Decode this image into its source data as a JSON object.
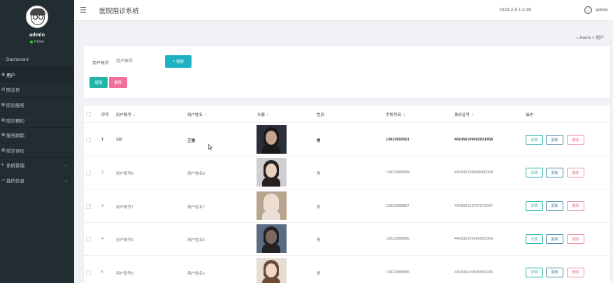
{
  "sidebar": {
    "user_name": "admin",
    "status": "Online",
    "items": [
      {
        "label": "Dashboard",
        "icon": "dashboard-icon",
        "glyph": "◌"
      },
      {
        "label": "用户",
        "icon": "grid-icon",
        "glyph": "▦"
      },
      {
        "label": "陪诊员",
        "icon": "grid-icon",
        "glyph": "▤"
      },
      {
        "label": "陪诊服务",
        "icon": "grid-icon",
        "glyph": "▦"
      },
      {
        "label": "陪诊预约",
        "icon": "grid-icon",
        "glyph": "▦"
      },
      {
        "label": "服务跟踪",
        "icon": "grid-icon",
        "glyph": "▦"
      },
      {
        "label": "陪诊评价",
        "icon": "grid-icon",
        "glyph": "▦"
      },
      {
        "label": "系统管理",
        "icon": "user-icon",
        "glyph": "●"
      },
      {
        "label": "我的信息",
        "icon": "card-icon",
        "glyph": "▭"
      }
    ]
  },
  "header": {
    "menu_icon": "☰",
    "title": "医院陪诊系统",
    "datetime": "2024-2-5 1:4:39",
    "user": "admin"
  },
  "breadcrumb": {
    "home": "Home",
    "separator": ">",
    "current": "用户"
  },
  "search": {
    "label": "用户账号",
    "placeholder": "用户账号",
    "search_button": "搜索",
    "add_button": "增加",
    "delete_button": "删除"
  },
  "table": {
    "columns": [
      "序号",
      "用户账号",
      "用户姓名",
      "头像",
      "性别",
      "手机号码",
      "身份证号",
      "操作"
    ],
    "sort_glyph": "⇕",
    "action_labels": {
      "detail": "详情",
      "edit": "更新",
      "delete": "删除"
    },
    "rows": [
      {
        "index": "1",
        "account": "111",
        "name": "王强",
        "gender": "男",
        "phone": "13823655551",
        "id_card": "441456199002031458"
      },
      {
        "index": "2",
        "account": "用户账号8",
        "name": "用户姓名8",
        "gender": "男",
        "phone": "13823888888",
        "id_card": "440300199808080008"
      },
      {
        "index": "3",
        "account": "用户账号7",
        "name": "用户姓名7",
        "gender": "男",
        "phone": "13823888887",
        "id_card": "440300199707070007"
      },
      {
        "index": "4",
        "account": "用户账号6",
        "name": "用户姓名6",
        "gender": "男",
        "phone": "13823888886",
        "id_card": "440300199606060006"
      },
      {
        "index": "5",
        "account": "用户账号5",
        "name": "用户姓名5",
        "gender": "男",
        "phone": "13823888885",
        "id_card": "440300199505050005"
      }
    ]
  },
  "colors": {
    "sidebar_bg": "#222d32",
    "accent_teal": "#1eb0c3",
    "add_green": "#23b6a6",
    "delete_pink": "#ef6f9d"
  }
}
